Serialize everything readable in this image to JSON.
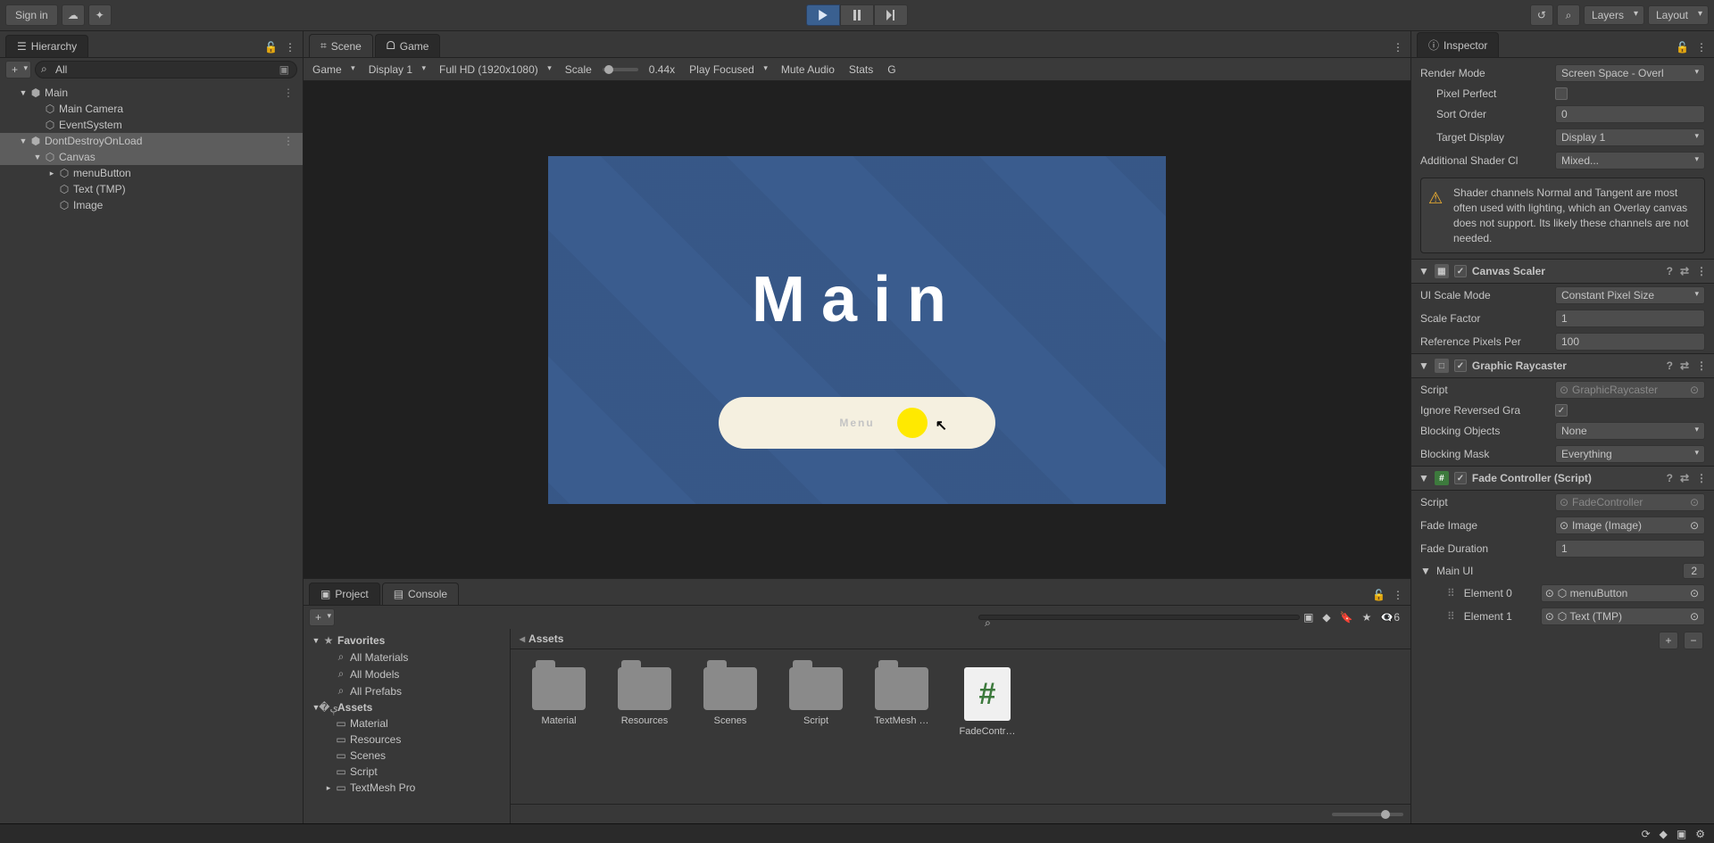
{
  "toolbar": {
    "signIn": "Sign in",
    "layers": "Layers",
    "layout": "Layout"
  },
  "hierarchy": {
    "title": "Hierarchy",
    "search": "All",
    "items": [
      {
        "indent": 0,
        "caret": "▼",
        "icon": "⬢",
        "label": "Main",
        "extra": "⋮"
      },
      {
        "indent": 1,
        "caret": "",
        "icon": "⬡",
        "label": "Main Camera"
      },
      {
        "indent": 1,
        "caret": "",
        "icon": "⬡",
        "label": "EventSystem"
      },
      {
        "indent": 0,
        "caret": "▼",
        "icon": "⬢",
        "label": "DontDestroyOnLoad",
        "extra": "⋮",
        "sel": true
      },
      {
        "indent": 1,
        "caret": "▼",
        "icon": "⬡",
        "label": "Canvas",
        "sel": true
      },
      {
        "indent": 2,
        "caret": "▸",
        "icon": "⬡",
        "label": "menuButton"
      },
      {
        "indent": 2,
        "caret": "",
        "icon": "⬡",
        "label": "Text (TMP)"
      },
      {
        "indent": 2,
        "caret": "",
        "icon": "⬡",
        "label": "Image"
      }
    ]
  },
  "sceneTabs": {
    "scene": "Scene",
    "game": "Game"
  },
  "gameToolbar": {
    "camera": "Game",
    "display": "Display 1",
    "resolution": "Full HD (1920x1080)",
    "scaleLabel": "Scale",
    "scaleValue": "0.44x",
    "focus": "Play Focused",
    "mute": "Mute Audio",
    "stats": "Stats",
    "gizmos": "G"
  },
  "gamePreview": {
    "title": "Main",
    "button": "Menu"
  },
  "project": {
    "tabProject": "Project",
    "tabConsole": "Console",
    "hiddenCount": "6",
    "breadcrumb": "Assets",
    "favorites": {
      "label": "Favorites",
      "items": [
        "All Materials",
        "All Models",
        "All Prefabs"
      ]
    },
    "assetsLabel": "Assets",
    "folders": [
      "Material",
      "Resources",
      "Scenes",
      "Script",
      "TextMesh Pro"
    ],
    "gridItems": [
      {
        "type": "folder",
        "label": "Material"
      },
      {
        "type": "folder",
        "label": "Resources"
      },
      {
        "type": "folder",
        "label": "Scenes"
      },
      {
        "type": "folder",
        "label": "Script"
      },
      {
        "type": "folder",
        "label": "TextMesh …"
      },
      {
        "type": "script",
        "label": "FadeContr…"
      }
    ]
  },
  "inspector": {
    "title": "Inspector",
    "renderMode": {
      "label": "Render Mode",
      "value": "Screen Space - Overl"
    },
    "pixelPerfect": {
      "label": "Pixel Perfect"
    },
    "sortOrder": {
      "label": "Sort Order",
      "value": "0"
    },
    "targetDisplay": {
      "label": "Target Display",
      "value": "Display 1"
    },
    "shaderCh": {
      "label": "Additional Shader Cl",
      "value": "Mixed..."
    },
    "warning": "Shader channels Normal and Tangent are most often used with lighting, which an Overlay canvas does not support. Its likely these channels are not needed.",
    "canvasScaler": {
      "title": "Canvas Scaler",
      "scaleMode": {
        "label": "UI Scale Mode",
        "value": "Constant Pixel Size"
      },
      "scaleFactor": {
        "label": "Scale Factor",
        "value": "1"
      },
      "refPixels": {
        "label": "Reference Pixels Per",
        "value": "100"
      }
    },
    "raycaster": {
      "title": "Graphic Raycaster",
      "script": {
        "label": "Script",
        "value": "GraphicRaycaster"
      },
      "ignoreRev": {
        "label": "Ignore Reversed Gra"
      },
      "blockingObj": {
        "label": "Blocking Objects",
        "value": "None"
      },
      "blockingMask": {
        "label": "Blocking Mask",
        "value": "Everything"
      }
    },
    "fade": {
      "title": "Fade Controller (Script)",
      "script": {
        "label": "Script",
        "value": "FadeController"
      },
      "fadeImage": {
        "label": "Fade Image",
        "value": "Image (Image)"
      },
      "fadeDuration": {
        "label": "Fade Duration",
        "value": "1"
      },
      "mainUI": {
        "label": "Main UI",
        "size": "2"
      },
      "elements": [
        {
          "label": "Element 0",
          "value": "menuButton"
        },
        {
          "label": "Element 1",
          "value": "Text (TMP)"
        }
      ]
    }
  }
}
